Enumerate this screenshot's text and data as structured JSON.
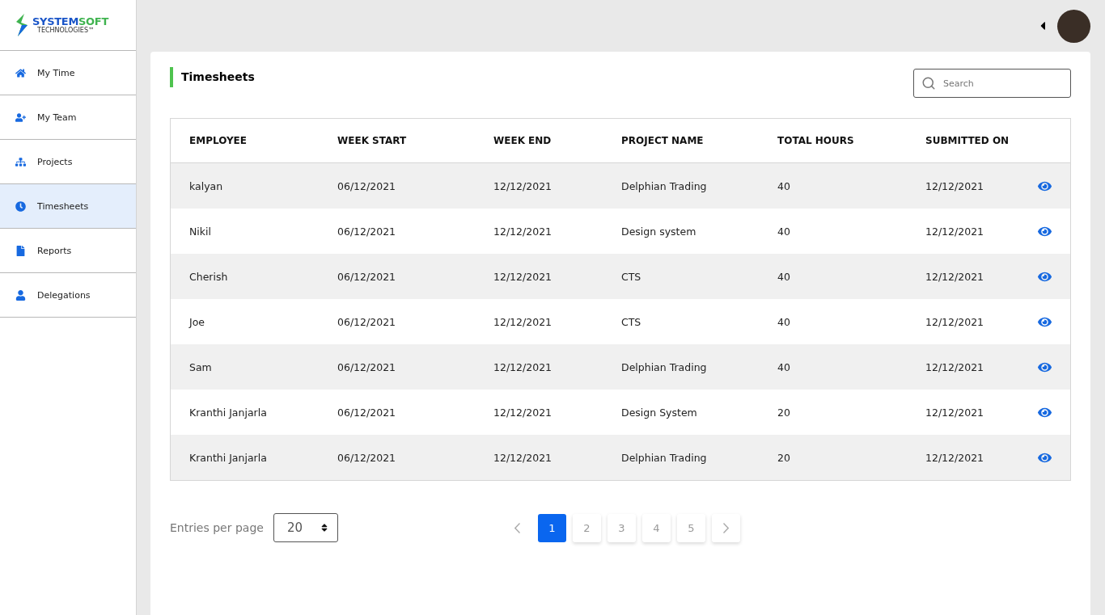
{
  "logo": {
    "word_1": "SYSTEM",
    "word_2": "SOFT",
    "tagline": "TECHNOLOGIES™"
  },
  "sidebar": {
    "items": [
      {
        "label": "My Time",
        "kind": "home",
        "selected": false
      },
      {
        "label": "My Team",
        "kind": "add-user",
        "selected": false
      },
      {
        "label": "Projects",
        "kind": "network",
        "selected": false
      },
      {
        "label": "Timesheets",
        "kind": "clock",
        "selected": true
      },
      {
        "label": "Reports",
        "kind": "file",
        "selected": false
      },
      {
        "label": "Delegations",
        "kind": "user",
        "selected": false
      }
    ]
  },
  "page": {
    "title": "Timesheets",
    "search": {
      "placeholder": "Search"
    }
  },
  "table": {
    "columns": [
      "EMPLOYEE",
      "WEEK START",
      "WEEK END",
      "PROJECT NAME",
      "TOTAL HOURS",
      "SUBMITTED ON"
    ],
    "rows": [
      [
        "kalyan",
        "06/12/2021",
        "12/12/2021",
        "Delphian Trading",
        "40",
        "12/12/2021"
      ],
      [
        "Nikil",
        "06/12/2021",
        "12/12/2021",
        "Design system",
        "40",
        "12/12/2021"
      ],
      [
        "Cherish",
        "06/12/2021",
        "12/12/2021",
        "CTS",
        "40",
        "12/12/2021"
      ],
      [
        "Joe",
        "06/12/2021",
        "12/12/2021",
        "CTS",
        "40",
        "12/12/2021"
      ],
      [
        "Sam",
        "06/12/2021",
        "12/12/2021",
        "Delphian Trading",
        "40",
        "12/12/2021"
      ],
      [
        "Kranthi Janjarla",
        "06/12/2021",
        "12/12/2021",
        "Design System",
        "20",
        "12/12/2021"
      ],
      [
        "Kranthi Janjarla",
        "06/12/2021",
        "12/12/2021",
        "Delphian Trading",
        "20",
        "12/12/2021"
      ]
    ]
  },
  "footer": {
    "entries_label": "Entries per page",
    "entries_value": "20",
    "pages": [
      {
        "label": "1",
        "selected": true
      },
      {
        "label": "2",
        "selected": false
      },
      {
        "label": "3",
        "selected": false
      },
      {
        "label": "4",
        "selected": false
      },
      {
        "label": "5",
        "selected": false
      }
    ]
  }
}
